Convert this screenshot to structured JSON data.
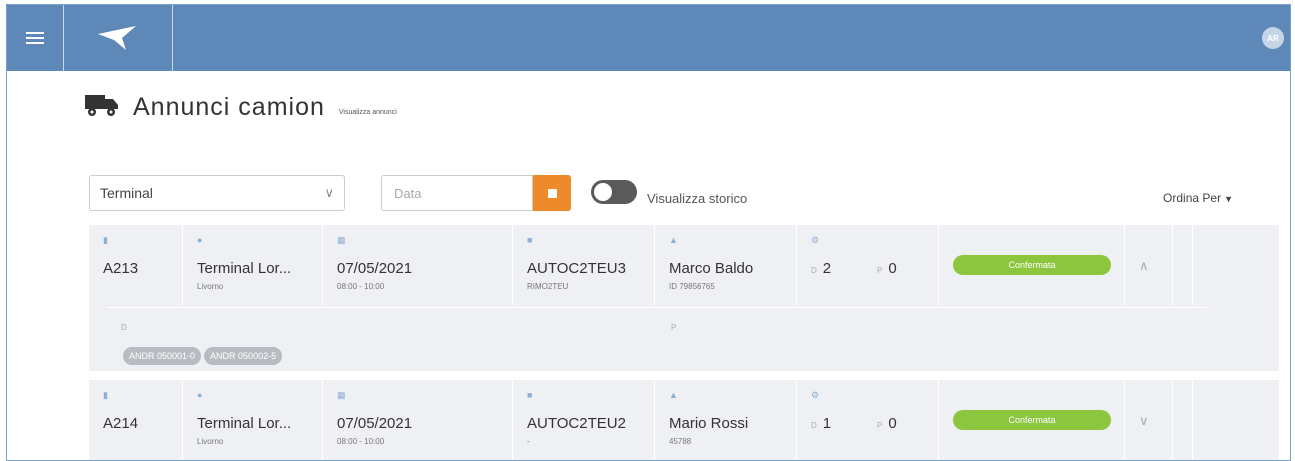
{
  "header": {
    "avatar_initials": "AR"
  },
  "page": {
    "title": "Annunci camion",
    "subtitle": "Visualizza annunci"
  },
  "filters": {
    "terminal_select_value": "Terminal",
    "date_placeholder": "Data",
    "history_toggle_label": "Visualizza storico",
    "sort_label": "Ordina Per"
  },
  "rows": [
    {
      "code": "A213",
      "terminal": "Terminal Lor...",
      "terminal_sub": "Livorno",
      "date": "07/05/2021",
      "time": "08:00 - 10:00",
      "vehicle": "AUTOC2TEU3",
      "vehicle_sub": "RIMO2TEU",
      "driver": "Marco Baldo",
      "driver_sub": "ID 79856765",
      "count_d": "2",
      "count_p": "0",
      "status": "Confermata",
      "ext_label_left": "D",
      "ext_label_right": "P",
      "chips": [
        "ANDR 050001-0",
        "ANDR 050002-5"
      ]
    },
    {
      "code": "A214",
      "terminal": "Terminal Lor...",
      "terminal_sub": "Livorno",
      "date": "07/05/2021",
      "time": "08:00 - 10:00",
      "vehicle": "AUTOC2TEU2",
      "vehicle_sub": "-",
      "driver": "Mario Rossi",
      "driver_sub": "45788",
      "count_d": "1",
      "count_p": "0",
      "status": "Confermata"
    }
  ],
  "colors": {
    "header": "#5e88b8",
    "status_ok": "#8cc63f",
    "accent": "#ee8a2a"
  },
  "icons": [
    "menu-icon",
    "logo-icon",
    "truck-icon",
    "calendar-icon",
    "chevron-down-icon",
    "chevron-up-icon",
    "pin-icon",
    "location-icon",
    "truck-small-icon",
    "user-icon",
    "gear-icon"
  ]
}
